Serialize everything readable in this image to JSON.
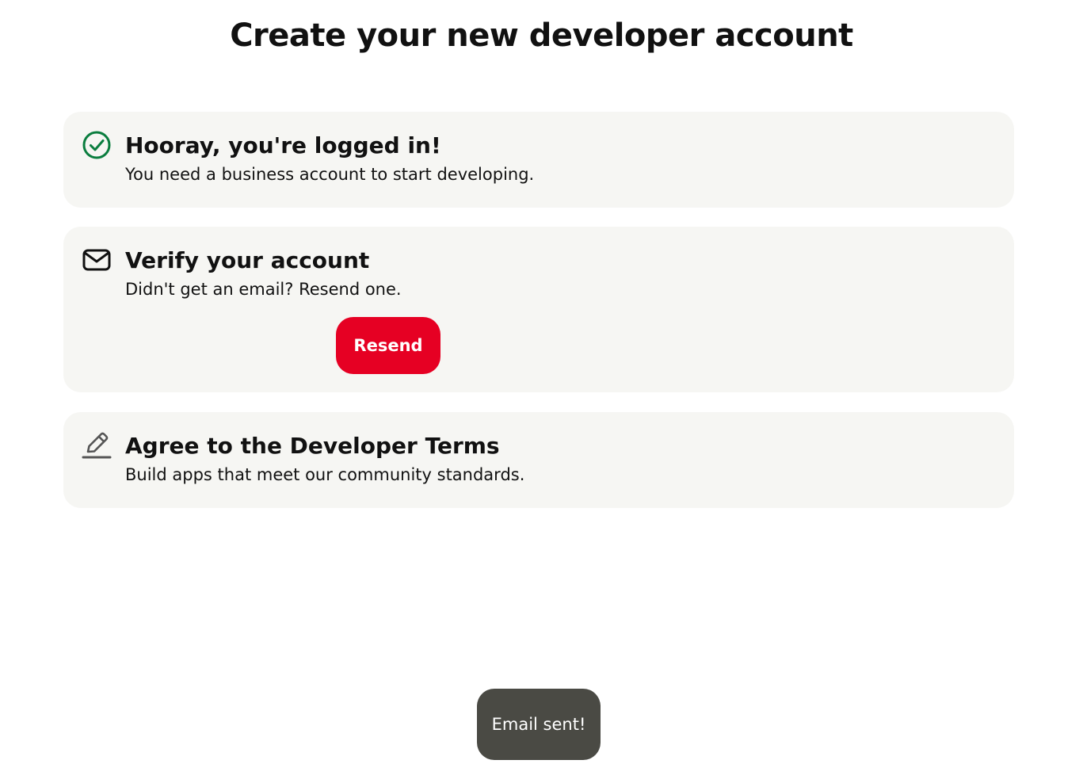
{
  "page": {
    "title": "Create your new developer account"
  },
  "steps": [
    {
      "icon": "check-circle-icon",
      "title": "Hooray, you're logged in!",
      "description": "You need a business account to start developing."
    },
    {
      "icon": "envelope-icon",
      "title": "Verify your account",
      "description": "Didn't get an email? Resend one.",
      "button_label": "Resend"
    },
    {
      "icon": "pencil-icon",
      "title": "Agree to the Developer Terms",
      "description": "Build apps that meet our community standards."
    }
  ],
  "toast": {
    "message": "Email sent!"
  },
  "colors": {
    "accent": "#e60023",
    "success": "#0a7d3e",
    "card_background": "#f6f6f3",
    "toast_background": "#4a4a44"
  }
}
